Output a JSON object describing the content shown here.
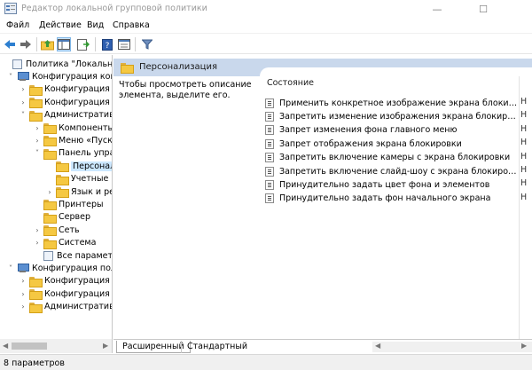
{
  "window": {
    "title": "Редактор локальной групповой политики",
    "minimize_glyph": "—",
    "maximize_glyph": "☐"
  },
  "menu": [
    "Файл",
    "Действие",
    "Вид",
    "Справка"
  ],
  "toolbar_icons": [
    "back-arrow-icon",
    "forward-arrow-icon",
    "up-folder-icon",
    "show-hide-tree-icon",
    "export-list-icon",
    "help-icon",
    "properties-icon",
    "filter-icon"
  ],
  "tree": [
    {
      "label": "Политика \"Локальный",
      "icon": "document-icon",
      "chev": "",
      "indent": 0
    },
    {
      "label": "Конфигурация комп",
      "icon": "computer-icon",
      "chev": "˅",
      "indent": 1
    },
    {
      "label": "Конфигурация п",
      "icon": "folder-icon",
      "chev": "›",
      "indent": 2
    },
    {
      "label": "Конфигурация W",
      "icon": "folder-icon",
      "chev": "›",
      "indent": 2
    },
    {
      "label": "Административ",
      "icon": "folder-icon",
      "chev": "˅",
      "indent": 2
    },
    {
      "label": "Компоненты",
      "icon": "folder-icon",
      "chev": "›",
      "indent": 3
    },
    {
      "label": "Меню «Пуск",
      "icon": "folder-icon",
      "chev": "›",
      "indent": 3
    },
    {
      "label": "Панель упра",
      "icon": "folder-icon",
      "chev": "˅",
      "indent": 3
    },
    {
      "label": "Персонал",
      "icon": "folder-icon",
      "chev": "",
      "indent": 4,
      "selected": true
    },
    {
      "label": "Учетные з",
      "icon": "folder-icon",
      "chev": "",
      "indent": 4
    },
    {
      "label": "Язык и ре",
      "icon": "folder-icon",
      "chev": "›",
      "indent": 4
    },
    {
      "label": "Принтеры",
      "icon": "folder-icon",
      "chev": "",
      "indent": 3
    },
    {
      "label": "Сервер",
      "icon": "folder-icon",
      "chev": "",
      "indent": 3
    },
    {
      "label": "Сеть",
      "icon": "folder-icon",
      "chev": "›",
      "indent": 3
    },
    {
      "label": "Система",
      "icon": "folder-icon",
      "chev": "›",
      "indent": 3
    },
    {
      "label": "Все параметр",
      "icon": "document-icon",
      "chev": "",
      "indent": 3
    },
    {
      "label": "Конфигурация поль",
      "icon": "computer-icon",
      "chev": "˅",
      "indent": 1
    },
    {
      "label": "Конфигурация п",
      "icon": "folder-icon",
      "chev": "›",
      "indent": 2
    },
    {
      "label": "Конфигурация W",
      "icon": "folder-icon",
      "chev": "›",
      "indent": 2
    },
    {
      "label": "Административ",
      "icon": "folder-icon",
      "chev": "›",
      "indent": 2
    }
  ],
  "panel": {
    "title": "Персонализация",
    "description": "Чтобы просмотреть описание элемента, выделите его.",
    "column_header": "Состояние"
  },
  "settings": [
    {
      "label": "Применить конкретное изображение экрана блокировк...",
      "state": "Н"
    },
    {
      "label": "Запретить изменение изображения экрана блокировки и...",
      "state": "Н"
    },
    {
      "label": "Запрет изменения фона главного меню",
      "state": "Н"
    },
    {
      "label": "Запрет отображения экрана блокировки",
      "state": "Н"
    },
    {
      "label": "Запретить включение камеры с экрана блокировки",
      "state": "Н"
    },
    {
      "label": "Запретить включение слайд-шоу с экрана блокировки",
      "state": "Н"
    },
    {
      "label": "Принудительно задать цвет фона и элементов",
      "state": "Н"
    },
    {
      "label": "Принудительно задать фон начального экрана",
      "state": "Н"
    }
  ],
  "tabs": [
    "Расширенный",
    "Стандартный"
  ],
  "status": "8 параметров",
  "colors": {
    "header_band": "#c9d8ec",
    "selection": "#cce8ff",
    "folder": "#f5c842"
  }
}
